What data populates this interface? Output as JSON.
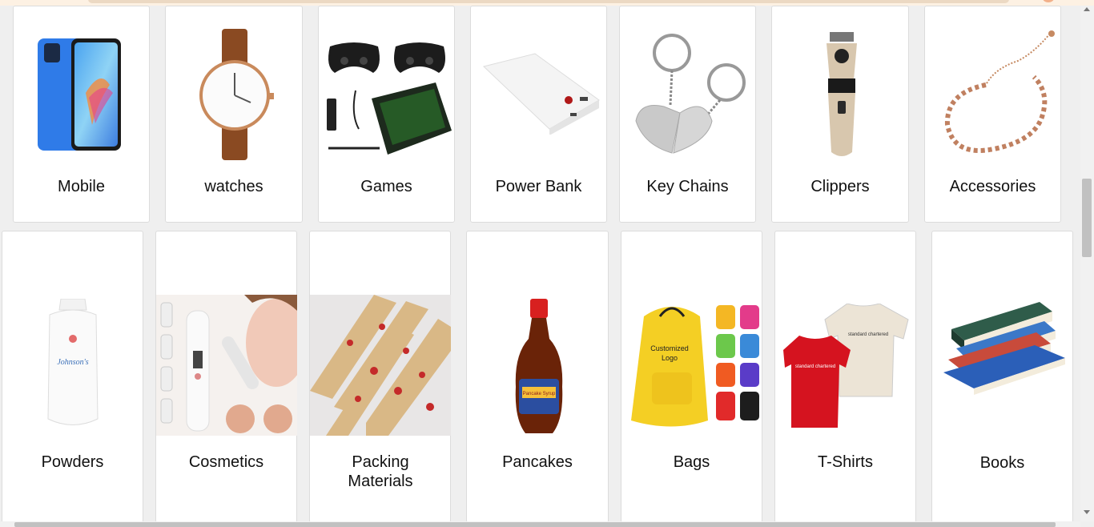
{
  "categories_row1": [
    {
      "label": "Mobile",
      "icon": "mobile-phone-image"
    },
    {
      "label": "watches",
      "icon": "watch-image"
    },
    {
      "label": "Games",
      "icon": "game-controllers-image"
    },
    {
      "label": "Power Bank",
      "icon": "power-bank-image"
    },
    {
      "label": "Key Chains",
      "icon": "key-chains-image"
    },
    {
      "label": "Clippers",
      "icon": "hair-clipper-image"
    },
    {
      "label": "Accessories",
      "icon": "bracelet-image"
    }
  ],
  "categories_row2": [
    {
      "label": "Powders",
      "icon": "powder-bottle-image"
    },
    {
      "label": "Cosmetics",
      "icon": "cosmetic-device-image"
    },
    {
      "label": "Packing Materials",
      "icon": "wrapping-paper-image"
    },
    {
      "label": "Pancakes",
      "icon": "syrup-bottle-image"
    },
    {
      "label": "Bags",
      "icon": "backpacks-image",
      "image_text": "Customized Logo"
    },
    {
      "label": "T-Shirts",
      "icon": "football-shirts-image"
    },
    {
      "label": "Books",
      "icon": "book-stack-image"
    }
  ],
  "image_texts": {
    "bags_logo_line1": "Customized",
    "bags_logo_line2": "Logo"
  },
  "colors": {
    "page_background": "#efefef",
    "card_background": "#ffffff"
  }
}
